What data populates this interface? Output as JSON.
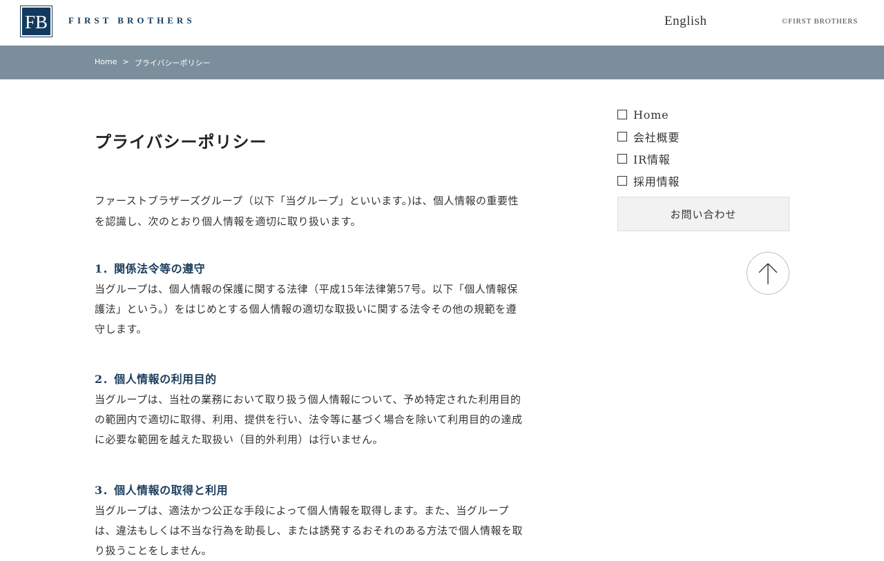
{
  "header": {
    "logo_text": "FB",
    "brand": "FIRST BROTHERS",
    "language_link": "English",
    "copyright": "©FIRST BROTHERS"
  },
  "breadcrumb": {
    "home": "Home",
    "separator": ">",
    "current": "プライバシーポリシー"
  },
  "page": {
    "title": "プライバシーポリシー",
    "intro": "ファーストブラザーズグループ（以下「当グループ」といいます。)は、個人情報の重要性を認識し、次のとおり個人情報を適切に取り扱います。",
    "sections": [
      {
        "heading": "1．関係法令等の遵守",
        "body": "当グループは、個人情報の保護に関する法律（平成15年法律第57号。以下「個人情報保護法」という。）をはじめとする個人情報の適切な取扱いに関する法令その他の規範を遵守します。"
      },
      {
        "heading": "2．個人情報の利用目的",
        "body": "当グループは、当社の業務において取り扱う個人情報について、予め特定された利用目的の範囲内で適切に取得、利用、提供を行い、法令等に基づく場合を除いて利用目的の達成に必要な範囲を越えた取扱い（目的外利用）は行いません。"
      },
      {
        "heading": "3．個人情報の取得と利用",
        "body": "当グループは、適法かつ公正な手段によって個人情報を取得します。また、当グループは、違法もしくは不当な行為を助長し、または誘発するおそれのある方法で個人情報を取り扱うことをしません。"
      }
    ]
  },
  "sidebar": {
    "items": [
      "Home",
      "会社概要",
      "IR情報",
      "採用情報"
    ],
    "contact_button": "お問い合わせ"
  },
  "icons": {
    "checkbox": "square-icon",
    "back_to_top": "arrow-up-icon"
  },
  "colors": {
    "brand_navy": "#133a5e",
    "breadcrumb_bar": "#7a8f9b",
    "heading_blue": "#1b3d5c"
  }
}
